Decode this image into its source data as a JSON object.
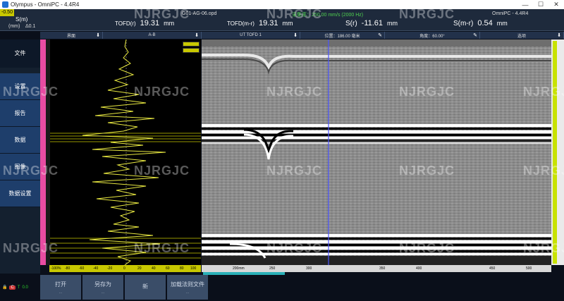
{
  "window": {
    "title": "Olympus - OmniPC - 4.4R4",
    "min": "—",
    "max": "☐",
    "close": "✕"
  },
  "header": {
    "indicator_value": "-0.50",
    "s_label": "S(m)",
    "unit": "(mm)",
    "delta": "Δ0.1",
    "file_name": "G01-AG-06.opd",
    "sample_rate": "采集率：250.00 mm/s (2000 Hz)",
    "version": "OmniPC - 4.4R4",
    "readouts": [
      {
        "label": "TOFD(r)",
        "value": "19.31",
        "unit": "mm"
      },
      {
        "label": "TOFD(m-r)",
        "value": "19.31",
        "unit": "mm"
      },
      {
        "label": "S(r)",
        "value": "-11.61",
        "unit": "mm"
      },
      {
        "label": "S(m-r)",
        "value": "0.54",
        "unit": "mm"
      }
    ]
  },
  "gatebar": {
    "seg1": "界面",
    "seg2": "A-B",
    "seg3": "UT TOFD 1",
    "seg4": "位置：186.00 毫米",
    "seg5": "角度：60.00°",
    "seg6": "选项"
  },
  "nav": [
    {
      "label": "文件"
    },
    {
      "label": "设置"
    },
    {
      "label": "报告"
    },
    {
      "label": "数据"
    },
    {
      "label": "图像"
    },
    {
      "label": "数据设置"
    }
  ],
  "hruler_ticks": [
    "-100%",
    "-80",
    "-60",
    "-40",
    "-20",
    "0",
    "20",
    "40",
    "60",
    "80",
    "100"
  ],
  "bruler_ticks": [
    "200mm",
    "250",
    "300",
    "350",
    "400",
    "450",
    "500"
  ],
  "status": {
    "connection": "C",
    "recording": "T",
    "battery": "0.0"
  },
  "softkeys": [
    {
      "label": "打开",
      "dots": "..."
    },
    {
      "label": "另存为",
      "dots": "..."
    },
    {
      "label": "新",
      "dots": ""
    },
    {
      "label": "加载法则文件",
      "dots": "..."
    }
  ],
  "watermark": "NJRGJC",
  "colors": {
    "accent": "#c8c800",
    "nav_blue": "#1e3e6b",
    "pink_ruler": "#e84ca2",
    "green": "#2bd12b"
  }
}
